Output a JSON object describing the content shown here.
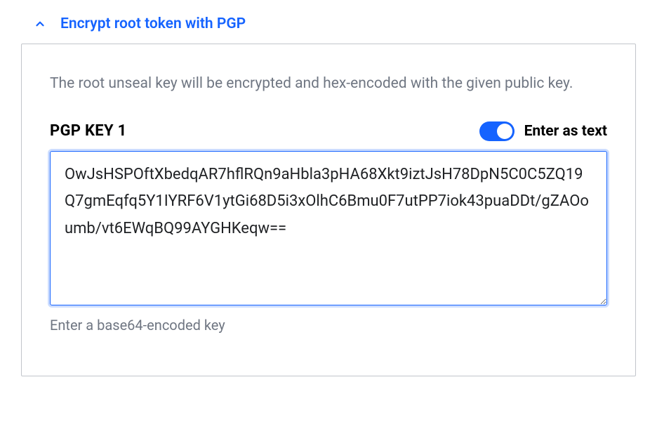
{
  "accordion": {
    "title": "Encrypt root token with PGP"
  },
  "panel": {
    "description": "The root unseal key will be encrypted and hex-encoded with the given public key.",
    "field_label": "PGP KEY 1",
    "toggle_label": "Enter as text",
    "toggle_on": true,
    "textarea_value": "OwJsHSPOftXbedqAR7hflRQn9aHbla3pHA68Xkt9iztJsH78DpN5C0C5ZQ19Q7gmEqfq5Y1IYRF6V1ytGi68D5i3xOlhC6Bmu0F7utPP7iok43puaDDt/gZAOoumb/vt6EWqBQ99AYGHKeqw==",
    "helper_text": "Enter a base64-encoded key"
  }
}
